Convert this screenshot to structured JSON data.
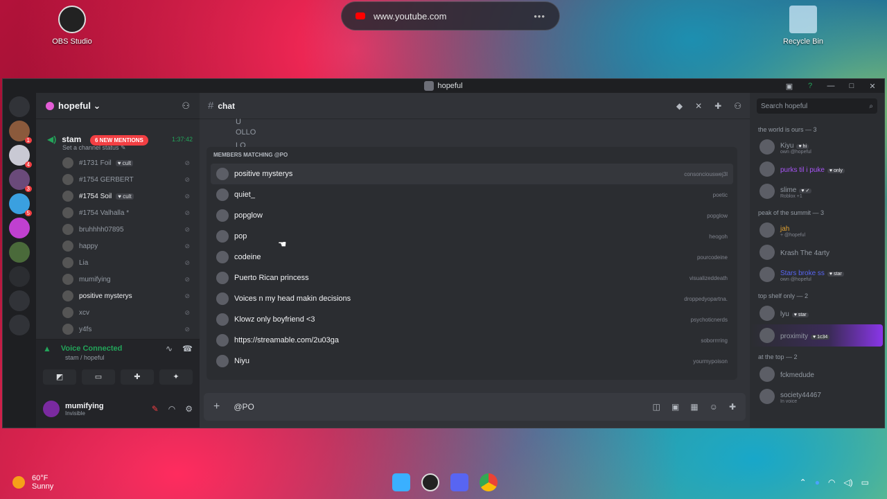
{
  "desktop": {
    "obs_label": "OBS Studio",
    "recycle_label": "Recycle Bin",
    "url": "www.youtube.com",
    "url_more": "•••"
  },
  "window": {
    "title": "hopeful",
    "min": "—",
    "max": "□",
    "close": "✕"
  },
  "server": {
    "name": "hopeful ⌄",
    "mentions_badge": "6 NEW MENTIONS",
    "voice_channel": "stam",
    "voice_time": "1:37:42",
    "status_hint": "Set a channel status ✎",
    "voice_users": [
      {
        "name": "#1731 Foil",
        "tag": "♥ cult",
        "bright": false
      },
      {
        "name": "#1754 GERBERT",
        "tag": "",
        "bright": false
      },
      {
        "name": "#1754 Soil",
        "tag": "♥ cult",
        "bright": true
      },
      {
        "name": "#1754 Valhalla *",
        "tag": "",
        "bright": false
      },
      {
        "name": "bruhhhh07895",
        "tag": "",
        "bright": false
      },
      {
        "name": "happy",
        "tag": "",
        "bright": false
      },
      {
        "name": "Lia",
        "tag": "",
        "bright": false
      },
      {
        "name": "mumifying",
        "tag": "",
        "bright": false
      },
      {
        "name": "positive mysterys",
        "tag": "",
        "bright": true
      },
      {
        "name": "xcv",
        "tag": "",
        "bright": false
      },
      {
        "name": "y4fs",
        "tag": "",
        "bright": false
      }
    ]
  },
  "voice_panel": {
    "title": "Voice Connected",
    "sub": "stam / hopeful"
  },
  "user_panel": {
    "name": "mumifying",
    "status": "Invisible"
  },
  "channel": {
    "name": "chat",
    "messages": [
      "U",
      "OLLO",
      "LO"
    ]
  },
  "autocomplete": {
    "label": "MEMBERS MATCHING @PO",
    "items": [
      {
        "name": "positive mysterys",
        "username": "consonciouswej3l"
      },
      {
        "name": "quiet_",
        "username": "poetic"
      },
      {
        "name": "popglow",
        "username": "popglow"
      },
      {
        "name": "pop",
        "username": "heogoh"
      },
      {
        "name": "codeine",
        "username": "pourcodeine"
      },
      {
        "name": "Puerto Rican princess",
        "username": "visualizeddeath"
      },
      {
        "name": "Voices n my head makin decisions",
        "username": "droppedyopartna."
      },
      {
        "name": "Klowz only boyfriend <3",
        "username": "psychoticnerds"
      },
      {
        "name": "https://streamable.com/2u03ga",
        "username": "soborrrring"
      },
      {
        "name": "Niyu",
        "username": "yourmypoison"
      }
    ]
  },
  "composer": {
    "value": "@PO"
  },
  "members": {
    "search_placeholder": "Search hopeful",
    "groups": [
      {
        "title": "the world is ours — 3",
        "items": [
          {
            "name": "Kiyu",
            "tag": "♥ hi",
            "sub": "own @hopeful",
            "color": "#949ba4"
          },
          {
            "name": "purks til i puke",
            "tag": "♥ only",
            "sub": "",
            "color": "#a855f7"
          },
          {
            "name": "slime",
            "tag": "♥ ✓",
            "sub": "Roblox +1",
            "color": "#949ba4"
          }
        ]
      },
      {
        "title": "peak of the summit — 3",
        "items": [
          {
            "name": "jah",
            "tag": "",
            "sub": "+ @hopeful",
            "color": "#e0a030"
          },
          {
            "name": "Krash The 4arty",
            "tag": "",
            "sub": "",
            "color": "#949ba4"
          },
          {
            "name": "Stars broke ss",
            "tag": "♥ star",
            "sub": "own @hopeful",
            "color": "#5865f2"
          }
        ]
      },
      {
        "title": "top shelf only — 2",
        "items": [
          {
            "name": "lyu",
            "tag": "♥ star",
            "sub": "",
            "color": "#949ba4"
          },
          {
            "name": "proximity",
            "tag": "♥ 1c34",
            "sub": "",
            "color": "#949ba4",
            "hl": true
          }
        ]
      },
      {
        "title": "at the top — 2",
        "items": [
          {
            "name": "fckmedude",
            "tag": "",
            "sub": "",
            "color": "#949ba4"
          },
          {
            "name": "society44467",
            "tag": "",
            "sub": "In voice",
            "color": "#949ba4"
          }
        ]
      }
    ]
  },
  "taskbar": {
    "temp": "60°F",
    "cond": "Sunny"
  }
}
